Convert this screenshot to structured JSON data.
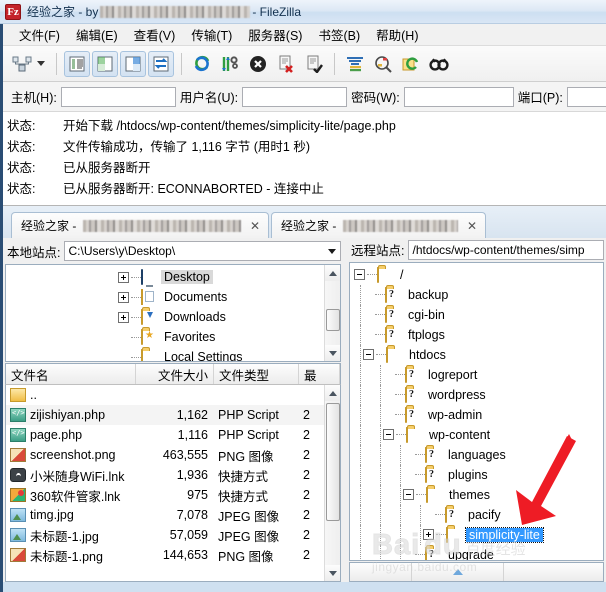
{
  "window": {
    "title_prefix": "经验之家 - by",
    "title_suffix": " - FileZilla",
    "logo_text": "Fz"
  },
  "menubar": {
    "items": [
      {
        "label": "文件(F)",
        "name": "menu-file"
      },
      {
        "label": "编辑(E)",
        "name": "menu-edit"
      },
      {
        "label": "查看(V)",
        "name": "menu-view"
      },
      {
        "label": "传输(T)",
        "name": "menu-transfer"
      },
      {
        "label": "服务器(S)",
        "name": "menu-server"
      },
      {
        "label": "书签(B)",
        "name": "menu-bookmarks"
      },
      {
        "label": "帮助(H)",
        "name": "menu-help"
      }
    ]
  },
  "toolbar": {
    "buttons": [
      {
        "name": "site-manager-icon",
        "title": "站点管理器"
      },
      {
        "name": "dropdown-caret-icon",
        "title": "打开站点管理器下拉"
      },
      {
        "name": "toggle-message-log-icon",
        "title": "显示/隐藏消息日志"
      },
      {
        "name": "toggle-local-tree-icon",
        "title": "显示/隐藏本地目录树"
      },
      {
        "name": "toggle-remote-tree-icon",
        "title": "显示/隐藏远程目录树"
      },
      {
        "name": "toggle-transfer-queue-icon",
        "title": "显示/隐藏传输队列"
      },
      {
        "name": "refresh-icon",
        "title": "刷新"
      },
      {
        "name": "process-queue-icon",
        "title": "处理队列"
      },
      {
        "name": "cancel-icon",
        "title": "取消当前操作"
      },
      {
        "name": "disconnect-icon",
        "title": "断开连接"
      },
      {
        "name": "reconnect-icon",
        "title": "重新连接"
      },
      {
        "name": "filter-icon",
        "title": "目录筛选"
      },
      {
        "name": "compare-directories-icon",
        "title": "目录比较"
      },
      {
        "name": "synchronized-browsing-icon",
        "title": "同步浏览"
      },
      {
        "name": "find-files-icon",
        "title": "搜索远程文件"
      }
    ]
  },
  "quickconnect": {
    "host_label": "主机(H):",
    "host_value": "",
    "user_label": "用户名(U):",
    "user_value": "",
    "pass_label": "密码(W):",
    "pass_value": "",
    "port_label": "端口(P):",
    "port_value": ""
  },
  "log": {
    "rows": [
      {
        "key": "状态:",
        "text": "开始下载 /htdocs/wp-content/themes/simplicity-lite/page.php"
      },
      {
        "key": "状态:",
        "text": "文件传输成功，传输了 1,116 字节 (用时1 秒)"
      },
      {
        "key": "状态:",
        "text": "已从服务器断开"
      },
      {
        "key": "状态:",
        "text": "已从服务器断开: ECONNABORTED - 连接中止"
      }
    ]
  },
  "tabs": [
    {
      "label": "经验之家 - ",
      "close": "✕",
      "active": false,
      "name": "tab-site-1"
    },
    {
      "label": "经验之家 - ",
      "close": "✕",
      "active": true,
      "name": "tab-site-2"
    }
  ],
  "local": {
    "site_label": "本地站点:",
    "site_path": "C:\\Users\\y\\Desktop\\",
    "tree": [
      {
        "label": "Desktop",
        "icon": "monitor-icon",
        "expander": "plus",
        "indent": 3,
        "selected": true
      },
      {
        "label": "Documents",
        "icon": "documents-folder-icon",
        "expander": "plus",
        "indent": 3,
        "selected": false
      },
      {
        "label": "Downloads",
        "icon": "downloads-folder-icon",
        "expander": "plus",
        "indent": 3,
        "selected": false
      },
      {
        "label": "Favorites",
        "icon": "favorites-folder-icon",
        "expander": "none",
        "indent": 3,
        "selected": false
      },
      {
        "label": "Local Settings",
        "icon": "folder-icon",
        "expander": "none",
        "indent": 3,
        "selected": false
      }
    ],
    "columns": [
      {
        "label": "文件名",
        "width": 130,
        "align": "left"
      },
      {
        "label": "文件大小",
        "width": 78,
        "align": "right"
      },
      {
        "label": "文件类型",
        "width": 85,
        "align": "left"
      },
      {
        "label": "最",
        "width": 28,
        "align": "left"
      }
    ],
    "rows": [
      {
        "name": "..",
        "icon": "up-folder-icon",
        "size": "",
        "type": "",
        "modified": ""
      },
      {
        "name": "zijishiyan.php",
        "icon": "php-file-icon",
        "size": "1,162",
        "type": "PHP Script",
        "modified": "2"
      },
      {
        "name": "page.php",
        "icon": "php-file-icon",
        "size": "1,116",
        "type": "PHP Script",
        "modified": "2"
      },
      {
        "name": "screenshot.png",
        "icon": "png-file-icon",
        "size": "463,555",
        "type": "PNG 图像",
        "modified": "2"
      },
      {
        "name": "小米随身WiFi.lnk",
        "icon": "wifi-shortcut-icon",
        "size": "1,936",
        "type": "快捷方式",
        "modified": "2"
      },
      {
        "name": "360软件管家.lnk",
        "icon": "360-shortcut-icon",
        "size": "975",
        "type": "快捷方式",
        "modified": "2"
      },
      {
        "name": "timg.jpg",
        "icon": "jpg-file-icon",
        "size": "7,078",
        "type": "JPEG 图像",
        "modified": "2"
      },
      {
        "name": "未标题-1.jpg",
        "icon": "jpg-file-icon",
        "size": "57,059",
        "type": "JPEG 图像",
        "modified": "2"
      },
      {
        "name": "未标题-1.png",
        "icon": "png-file-icon",
        "size": "144,653",
        "type": "PNG 图像",
        "modified": "2"
      }
    ]
  },
  "remote": {
    "site_label": "远程站点:",
    "site_path": "/htdocs/wp-content/themes/simp",
    "tree": [
      {
        "label": "/",
        "indent": 0,
        "expander": "minus",
        "icon": "folder-icon",
        "selected": false
      },
      {
        "label": "backup",
        "indent": 1,
        "expander": "none",
        "icon": "unknown-folder-icon",
        "selected": false
      },
      {
        "label": "cgi-bin",
        "indent": 1,
        "expander": "none",
        "icon": "unknown-folder-icon",
        "selected": false
      },
      {
        "label": "ftplogs",
        "indent": 1,
        "expander": "none",
        "icon": "unknown-folder-icon",
        "selected": false
      },
      {
        "label": "htdocs",
        "indent": 1,
        "expander": "minus",
        "icon": "folder-icon",
        "selected": false
      },
      {
        "label": "logreport",
        "indent": 2,
        "expander": "none",
        "icon": "unknown-folder-icon",
        "selected": false
      },
      {
        "label": "wordpress",
        "indent": 2,
        "expander": "none",
        "icon": "unknown-folder-icon",
        "selected": false
      },
      {
        "label": "wp-admin",
        "indent": 2,
        "expander": "none",
        "icon": "unknown-folder-icon",
        "selected": false
      },
      {
        "label": "wp-content",
        "indent": 2,
        "expander": "minus",
        "icon": "folder-icon",
        "selected": false
      },
      {
        "label": "languages",
        "indent": 3,
        "expander": "none",
        "icon": "unknown-folder-icon",
        "selected": false
      },
      {
        "label": "plugins",
        "indent": 3,
        "expander": "none",
        "icon": "unknown-folder-icon",
        "selected": false
      },
      {
        "label": "themes",
        "indent": 3,
        "expander": "minus",
        "icon": "folder-icon",
        "selected": false
      },
      {
        "label": "pacify",
        "indent": 4,
        "expander": "none",
        "icon": "unknown-folder-icon",
        "selected": false
      },
      {
        "label": "simplicity-lite",
        "indent": 4,
        "expander": "plus",
        "icon": "folder-icon",
        "selected": true
      },
      {
        "label": "upgrade",
        "indent": 3,
        "expander": "none",
        "icon": "unknown-folder-icon",
        "selected": false
      }
    ],
    "bottom_columns": [
      {
        "label": "",
        "width": 60
      },
      {
        "label": "",
        "width": 90
      }
    ]
  },
  "annotation": {
    "arrow_color": "#ee1c25",
    "watermark_logo": "Bai",
    "watermark_logo2": "du",
    "watermark_cn": "百度经验",
    "watermark_url": "jingyan.baidu.com"
  },
  "colors": {
    "selection_blue": "#3399ff",
    "titlebar_blue": "#2a4d74",
    "folder_yellow": "#f3c54f"
  }
}
